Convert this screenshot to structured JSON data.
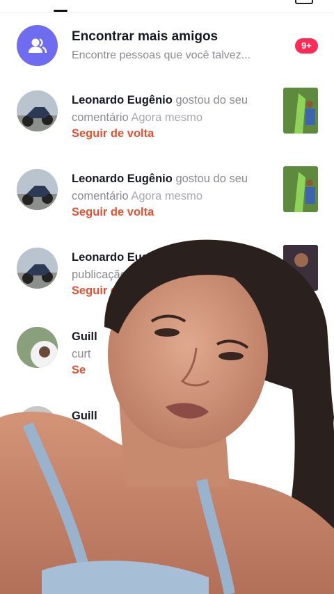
{
  "find_friends": {
    "title": "Encontrar mais amigos",
    "subtitle": "Encontre pessoas que você talvez...",
    "badge": "9+",
    "icon": "add-friends-icon",
    "accent": "#6f6cf0"
  },
  "notifications": [
    {
      "name": "Leonardo Eugênio",
      "action": "gostou do seu comentário",
      "time": "Agora mesmo",
      "follow": "Seguir de volta"
    },
    {
      "name": "Leonardo Eugênio",
      "action": "gostou do seu comentário",
      "time": "Agora mesmo",
      "follow": "Seguir de volta"
    },
    {
      "name": "Leonardo Eugê",
      "action": "publicação",
      "time": "",
      "follow": "Seguir de v"
    },
    {
      "name": "Guill",
      "action": "curt",
      "time": "",
      "follow": "Se"
    },
    {
      "name": "Guill",
      "action": "",
      "time": "",
      "follow": ""
    }
  ],
  "colors": {
    "follow": "#e5502e",
    "badge": "#fe2c55"
  }
}
